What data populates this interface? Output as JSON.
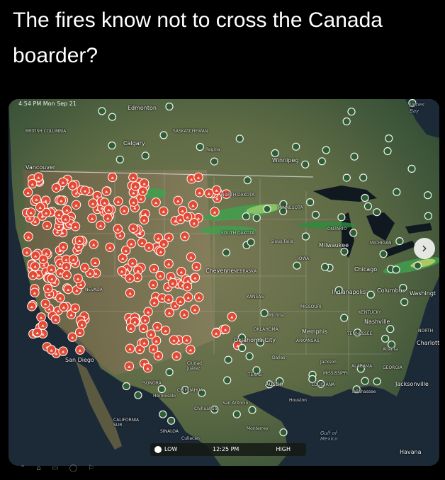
{
  "post": {
    "caption": "The fires know not to cross the Canada boarder?"
  },
  "map": {
    "status_text": "4:54 PM  Mon Sep 21",
    "legend": {
      "low": "LOW",
      "time": "12:25 PM",
      "high": "HIGH"
    },
    "labels": {
      "edmonton": "Edmonton",
      "british_columbia": "BRITISH COLUMBIA",
      "calgary": "Calgary",
      "saskatchewan": "SASKATCHEWAN",
      "regina": "Regina",
      "winnipeg": "Winnipeg",
      "james_bay": "James Bay",
      "vancouver": "Vancouver",
      "north_dakota": "NORTH DAKOTA",
      "minnesota": "MINNESOTA",
      "ontario": "ONTARIO",
      "south_dakota": "SOUTH DAKOTA",
      "sioux_falls": "Sioux Falls",
      "milwaukee": "Milwaukee",
      "michigan": "MICHIGAN",
      "cheyenne": "Cheyenne",
      "nebraska": "NEBRASKA",
      "iowa": "IOWA",
      "chicago": "Chicago",
      "kansas": "KANSAS",
      "indianapolis": "Indianapolis",
      "columbus": "Columbus",
      "washington": "Washingt",
      "nevada": "NEVADA",
      "wichita": "Wichita",
      "missouri": "MISSOURI",
      "kentucky": "KENTUCKY",
      "nashville": "Nashville",
      "oklahoma": "OKLAHOMA",
      "oklahoma_city": "Oklahoma City",
      "memphis": "Memphis",
      "tennessee": "TENNESSEE",
      "arkansas": "ARKANSAS",
      "north": "NORTH",
      "charlotte": "Charlotte",
      "san_diego": "San Diego",
      "atlanta": "Atlanta",
      "dallas": "Dallas",
      "texas": "TEXAS",
      "jackson": "Jackson",
      "alabama": "ALABAMA",
      "georgia": "GEORGIA",
      "ciudad_juarez": "Ciudad Juárez",
      "sonora": "SONORA",
      "chihuahua_state": "CHIHUAHUA",
      "hermosillo": "Hermosillo",
      "austin": "Austin",
      "louisiana": "LOUISIANA",
      "tallahassee": "Tallahassee",
      "jacksonville": "Jacksonville",
      "houston": "Houston",
      "san_antonio": "San Antonio",
      "chihuahua": "Chihuahua",
      "california_sur": "CALIFORNIA SUR",
      "sinaloa": "SINALOA",
      "culiacan": "Culiacán",
      "monterrey": "Monterrey",
      "gulf_of_mexico": "Gulf of Mexico",
      "havana": "Havana",
      "mississippi": "MISSISSIPPI"
    },
    "fire_marker_color": "#e24a33",
    "ring_marker_color": "#f2f2f2"
  },
  "bottom_nav_glyphs": "⌃ ⌂ ▭ ◯ ⚐"
}
